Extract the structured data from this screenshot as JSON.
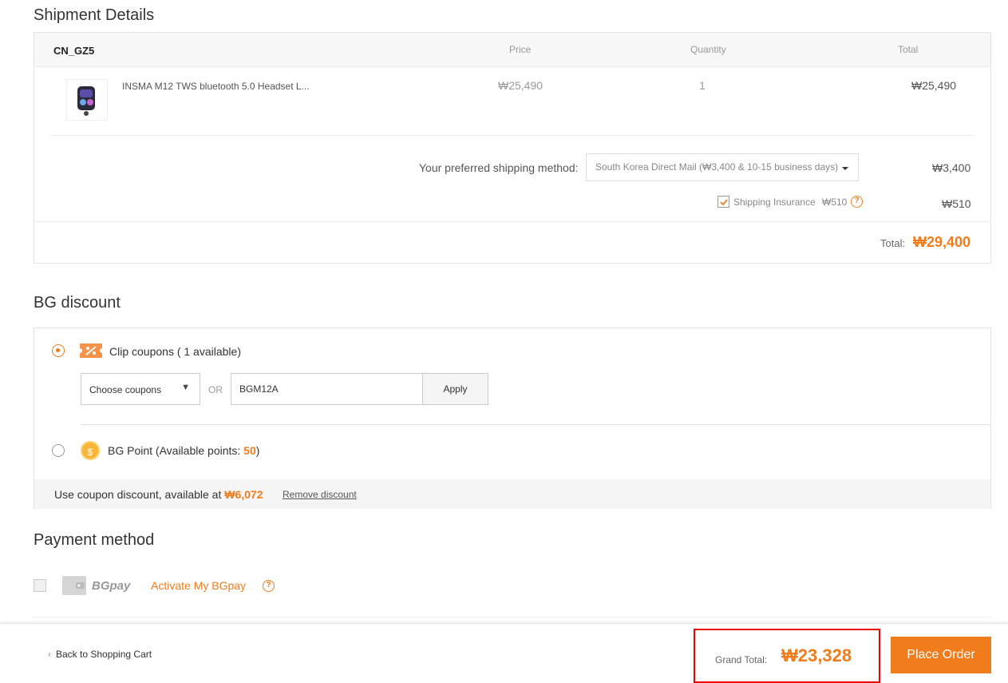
{
  "shipment": {
    "title": "Shipment Details",
    "warehouse": "CN_GZ5",
    "columns": {
      "price": "Price",
      "quantity": "Quantity",
      "total": "Total"
    },
    "item": {
      "name": "INSMA M12 TWS bluetooth 5.0 Headset L...",
      "price": "₩25,490",
      "quantity": "1",
      "total": "₩25,490"
    },
    "shipping_label": "Your preferred shipping method:",
    "shipping_method": "South Korea Direct Mail (₩3,400 & 10-15 business days)",
    "shipping_cost": "₩3,400",
    "insurance_label": "Shipping Insurance",
    "insurance_price": "₩510",
    "insurance_cost": "₩510",
    "insurance_checked": true,
    "total_label": "Total:",
    "total_value": "₩29,400"
  },
  "discount": {
    "title": "BG discount",
    "coupon_label": "Clip coupons ( 1 available)",
    "choose_coupons": "Choose coupons",
    "or": "OR",
    "coupon_code": "BGM12A",
    "apply": "Apply",
    "bg_point_prefix": "BG Point (Available points: ",
    "bg_points": "50",
    "bg_point_suffix": ")",
    "coupon_discount_prefix": "Use coupon discount, available at ",
    "coupon_discount_value": "₩6,072",
    "remove_discount": "Remove discount"
  },
  "payment": {
    "title": "Payment method",
    "bgpay": "BGpay",
    "activate": "Activate My BGpay"
  },
  "footer": {
    "back": "Back to Shopping Cart",
    "grand_total_label": "Grand Total:",
    "grand_total_value": "₩23,328",
    "place_order": "Place Order"
  },
  "colors": {
    "accent": "#f07c1c",
    "highlight_border": "#e00000"
  }
}
